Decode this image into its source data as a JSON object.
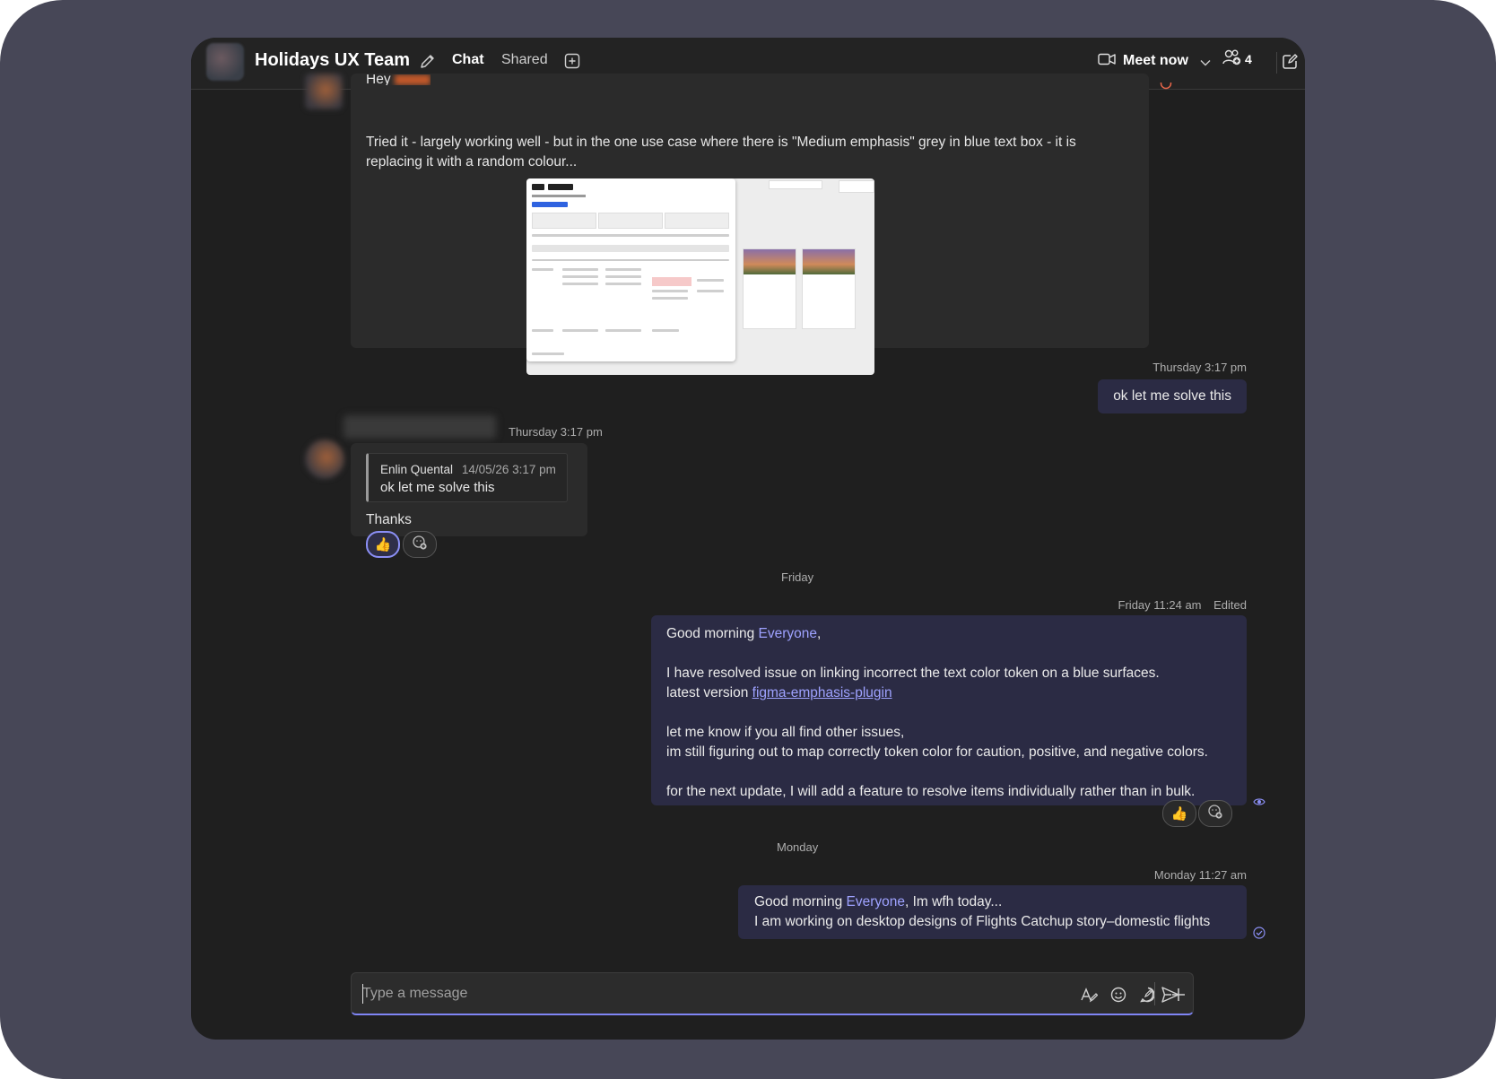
{
  "header": {
    "team_name": "Holidays UX Team",
    "tabs": [
      "Chat",
      "Shared"
    ],
    "meet_now": "Meet now",
    "participant_count": "4"
  },
  "messages": {
    "m1": {
      "greeting_partial": "Hey",
      "text": "Tried it - largely working well - but in the one use case where there is \"Medium emphasis\" grey in blue text box - it is replacing it with a random colour..."
    },
    "m2": {
      "timestamp": "Thursday 3:17 pm",
      "text": "ok let me solve this"
    },
    "m3": {
      "timestamp": "Thursday 3:17 pm",
      "quote_author": "Enlin Quental",
      "quote_time": "14/05/26 3:17 pm",
      "quote_text": "ok let me solve this",
      "text": "Thanks"
    },
    "day1": "Friday",
    "m4": {
      "timestamp": "Friday 11:24 am",
      "edited": "Edited",
      "greet_prefix": "Good morning ",
      "greet_mention": "Everyone",
      "greet_suffix": ",",
      "line2": "I have resolved issue on linking incorrect the text color token on a blue surfaces.",
      "line3_prefix": "latest version ",
      "line3_link": "figma-emphasis-plugin",
      "line4": "let me know if you all find other issues,",
      "line5": "im still figuring out to map correctly token color for caution, positive, and negative colors.",
      "line6": "for the next update, I will add a feature to resolve items individually rather than in bulk."
    },
    "day2": "Monday",
    "m5": {
      "timestamp": "Monday 11:27 am",
      "greet_prefix": "Good morning ",
      "greet_mention": "Everyone",
      "greet_suffix": ", Im wfh today...",
      "line2": "I am working on desktop designs of Flights Catchup story–domestic flights"
    }
  },
  "reactions": {
    "thumbs_up": "👍"
  },
  "composer": {
    "placeholder": "Type a message"
  },
  "colors": {
    "accent": "#7f85f5",
    "mention": "#9ea2ff",
    "outgoing_bubble": "#2b2b44",
    "incoming_bubble": "#2b2b2b"
  }
}
